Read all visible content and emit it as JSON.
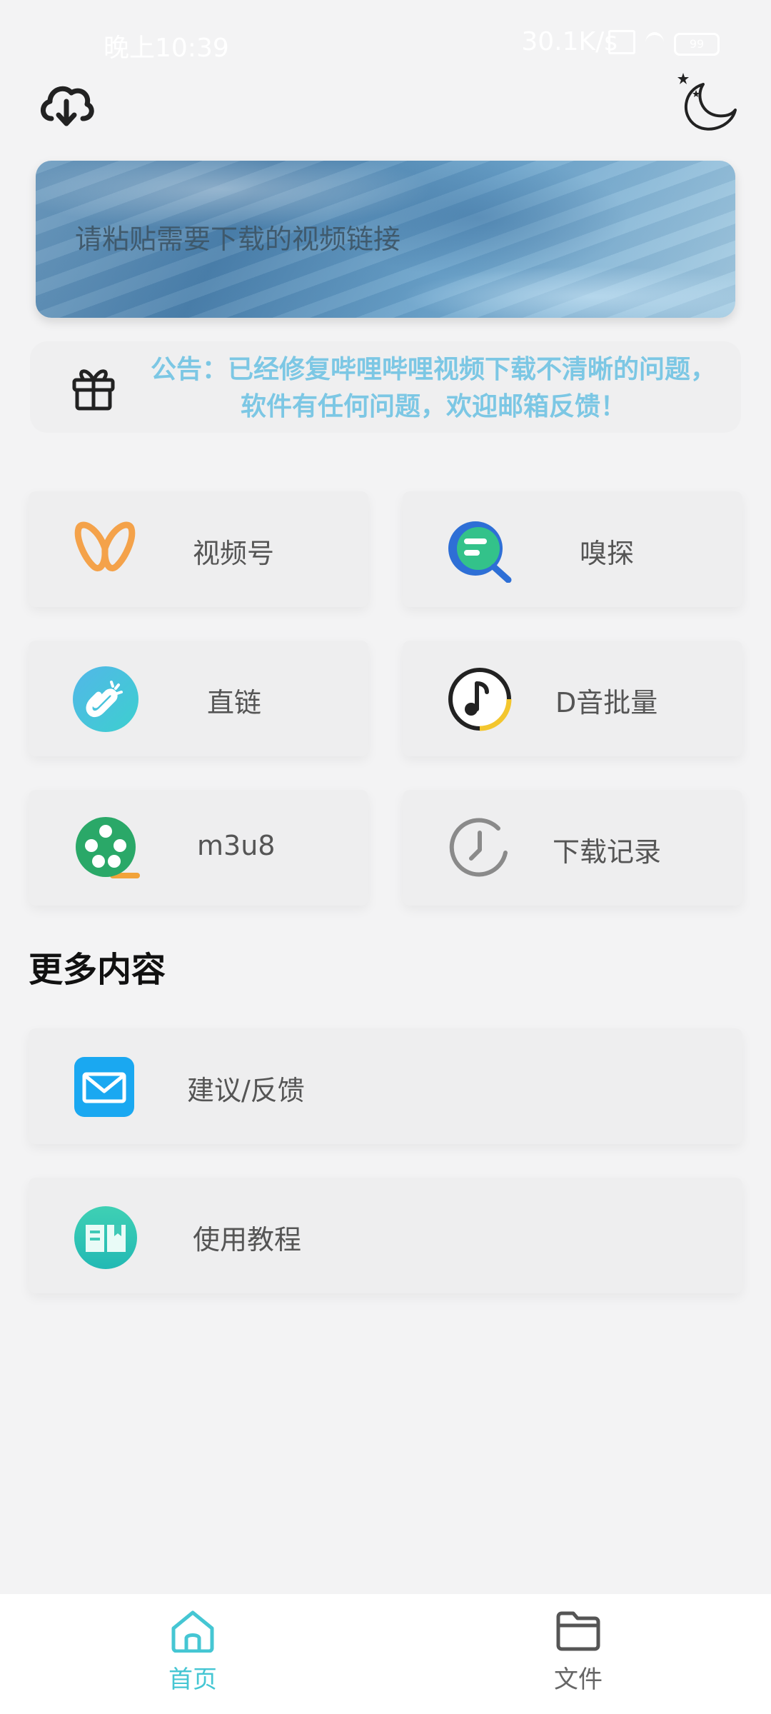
{
  "status_bar": {
    "time": "晚上10:39",
    "net_speed": "30.1K/s",
    "battery": "99"
  },
  "header": {
    "cloud_icon": "cloud-download-icon",
    "theme_icon": "moon-stars-icon"
  },
  "search": {
    "placeholder": "请粘贴需要下载的视频链接"
  },
  "notice": {
    "line1": "公告：已经修复哔哩哔哩视频下载不清晰的问题，",
    "line2": "软件有任何问题，欢迎邮箱反馈！"
  },
  "features": [
    {
      "label": "视频号",
      "icon": "channels-butterfly-icon"
    },
    {
      "label": "嗅探",
      "icon": "sniff-search-icon"
    },
    {
      "label": "直链",
      "icon": "magnet-link-icon"
    },
    {
      "label": "D音批量",
      "icon": "music-note-icon"
    },
    {
      "label": "m3u8",
      "icon": "film-reel-icon"
    },
    {
      "label": "下载记录",
      "icon": "history-clock-icon"
    }
  ],
  "more": {
    "title": "更多内容",
    "items": [
      {
        "label": "建议/反馈",
        "icon": "mail-icon"
      },
      {
        "label": "使用教程",
        "icon": "book-icon"
      }
    ]
  },
  "nav": {
    "home": "首页",
    "files": "文件"
  },
  "colors": {
    "accent": "#45c6d3",
    "notice_text": "#7cc7e4",
    "background": "#f3f3f4"
  }
}
